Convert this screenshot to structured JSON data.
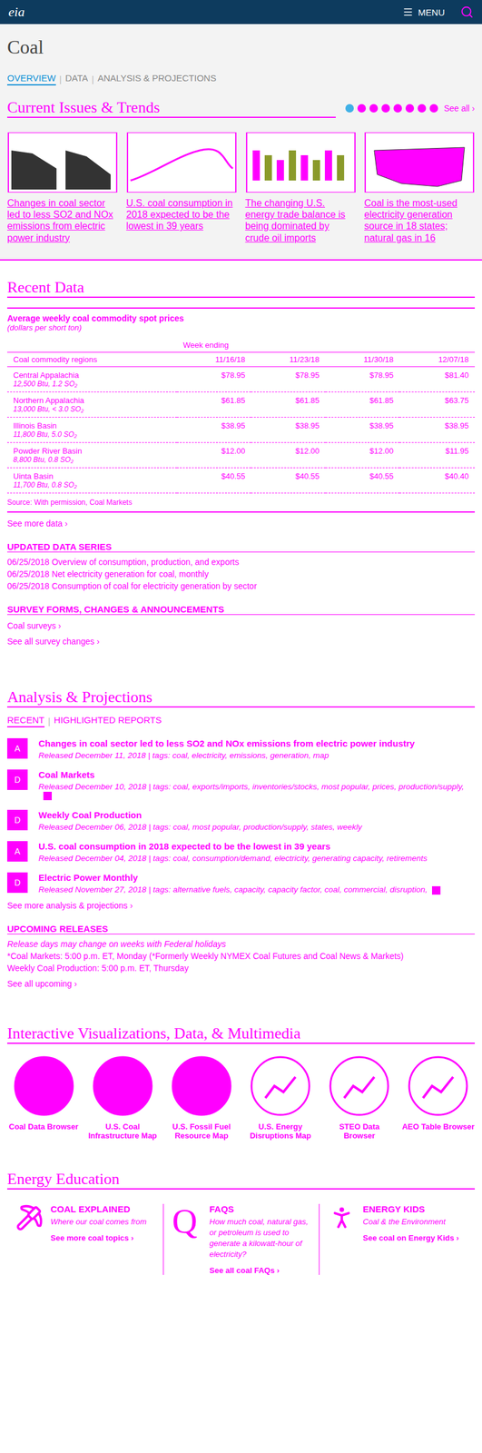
{
  "header": {
    "logo": "eia",
    "menu": "MENU"
  },
  "page": {
    "title": "Coal"
  },
  "tabs": [
    {
      "label": "OVERVIEW",
      "selected": true
    },
    {
      "label": "DATA",
      "selected": false
    },
    {
      "label": "ANALYSIS & PROJECTIONS",
      "selected": false
    }
  ],
  "issues": {
    "title": "Current Issues & Trends",
    "see_all": "See all ›",
    "dots": [
      {
        "selected": true
      },
      {
        "selected": false
      },
      {
        "selected": false
      },
      {
        "selected": false
      },
      {
        "selected": false
      },
      {
        "selected": false
      },
      {
        "selected": false
      },
      {
        "selected": false
      }
    ],
    "cards": [
      {
        "title": "Changes in coal sector led to less SO2 and NOx emissions from electric power industry"
      },
      {
        "title": "U.S. coal consumption in 2018 expected to be the lowest in 39 years"
      },
      {
        "title": "The changing U.S. energy trade balance is being dominated by crude oil imports"
      },
      {
        "title": "Coal is the most-used electricity generation source in 18 states; natural gas in 16"
      }
    ]
  },
  "recent_data": {
    "title": "Recent Data",
    "table": {
      "caption": "Average weekly coal commodity spot prices",
      "units": "(dollars per short ton)",
      "group_header": "Week ending",
      "columns": [
        "Coal commodity regions",
        "11/16/18",
        "11/23/18",
        "11/30/18",
        "12/07/18"
      ],
      "rows": [
        {
          "region": "Central Appalachia",
          "spec": "12,500 Btu, 1.2 SO₂",
          "values": [
            "$78.95",
            "$78.95",
            "$78.95",
            "$81.40"
          ]
        },
        {
          "region": "Northern Appalachia",
          "spec": "13,000 Btu, < 3.0 SO₂",
          "values": [
            "$61.85",
            "$61.85",
            "$61.85",
            "$63.75"
          ]
        },
        {
          "region": "Illinois Basin",
          "spec": "11,800 Btu, 5.0 SO₂",
          "values": [
            "$38.95",
            "$38.95",
            "$38.95",
            "$38.95"
          ]
        },
        {
          "region": "Powder River Basin",
          "spec": "8,800 Btu, 0.8 SO₂",
          "values": [
            "$12.00",
            "$12.00",
            "$12.00",
            "$11.95"
          ]
        },
        {
          "region": "Uinta Basin",
          "spec": "11,700 Btu, 0.8 SO₂",
          "values": [
            "$40.55",
            "$40.55",
            "$40.55",
            "$40.40"
          ]
        }
      ]
    },
    "source": "Source: With permission, Coal Markets",
    "see_more": "See more data ›",
    "updated_title": "UPDATED DATA SERIES",
    "updated": [
      {
        "date": "06/25/2018",
        "label": "Overview of consumption, production, and exports"
      },
      {
        "date": "06/25/2018",
        "label": "Net electricity generation for coal, monthly"
      },
      {
        "date": "06/25/2018",
        "label": "Consumption of coal for electricity generation by sector"
      }
    ],
    "survey_title": "SURVEY FORMS, CHANGES & ANNOUNCEMENTS",
    "survey_links": [
      "Coal surveys ›",
      "See all survey changes ›"
    ]
  },
  "analysis": {
    "title": "Analysis & Projections",
    "tabs": [
      {
        "label": "RECENT",
        "selected": true
      },
      {
        "label": "HIGHLIGHTED REPORTS",
        "selected": false
      }
    ],
    "items": [
      {
        "badge": "A",
        "title": "Changes in coal sector led to less SO2 and NOx emissions from electric power industry",
        "meta": "Released December 11, 2018 | tags: coal, electricity, emissions, generation, map",
        "expandable": false
      },
      {
        "badge": "D",
        "title": "Coal Markets",
        "meta": "Released December 10, 2018 | tags: coal, exports/imports, inventories/stocks, most popular, prices, production/supply,",
        "expandable": true
      },
      {
        "badge": "D",
        "title": "Weekly Coal Production",
        "meta": "Released December 06, 2018 | tags: coal, most popular, production/supply, states, weekly",
        "expandable": false
      },
      {
        "badge": "A",
        "title": "U.S. coal consumption in 2018 expected to be the lowest in 39 years",
        "meta": "Released December 04, 2018 | tags: coal, consumption/demand, electricity, generating capacity, retirements",
        "expandable": false
      },
      {
        "badge": "D",
        "title": "Electric Power Monthly",
        "meta": "Released November 27, 2018 | tags: alternative fuels, capacity, capacity factor, coal, commercial, disruption,",
        "expandable": true
      }
    ],
    "see_more": "See more analysis & projections ›"
  },
  "upcoming": {
    "title": "UPCOMING RELEASES",
    "note": "Release days may change on weeks with Federal holidays",
    "lines": [
      "*Coal Markets: 5:00 p.m. ET, Monday (*Formerly Weekly NYMEX Coal Futures and Coal News & Markets)",
      "Weekly Coal Production: 5:00 p.m. ET, Thursday"
    ],
    "see_all": "See all upcoming ›"
  },
  "interactive": {
    "title": "Interactive Visualizations, Data, & Multimedia",
    "items": [
      {
        "label": "Coal Data Browser"
      },
      {
        "label": "U.S. Coal Infrastructure Map"
      },
      {
        "label": "U.S. Fossil Fuel Resource Map"
      },
      {
        "label": "U.S. Energy Disruptions Map"
      },
      {
        "label": "STEO Data Browser"
      },
      {
        "label": "AEO Table Browser"
      }
    ]
  },
  "education": {
    "title": "Energy Education",
    "columns": [
      {
        "kind": "explained",
        "icon_letter": "",
        "heading": "COAL EXPLAINED",
        "text": "Where our coal comes from",
        "link": "See more coal topics ›"
      },
      {
        "kind": "faq",
        "icon_letter": "Q",
        "heading": "FAQS",
        "text": "How much coal, natural gas, or petroleum is used to generate a kilowatt-hour of electricity?",
        "link": "See all coal FAQs ›"
      },
      {
        "kind": "kids",
        "icon_letter": "",
        "heading": "ENERGY KIDS",
        "text": "Coal & the Environment",
        "link": "See coal on Energy Kids ›"
      }
    ]
  }
}
